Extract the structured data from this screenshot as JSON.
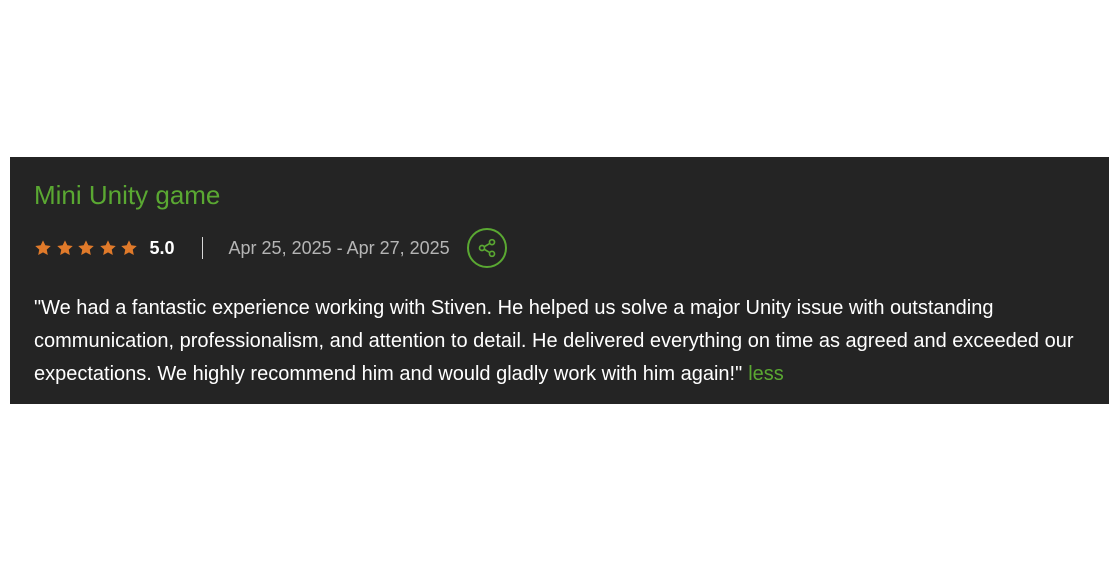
{
  "review": {
    "title": "Mini Unity game",
    "stars": 5,
    "rating": "5.0",
    "date_range": "Apr 25, 2025 - Apr 27, 2025",
    "share_icon": "share-icon",
    "text": "\"We had a fantastic experience working with Stiven. He helped us solve a major Unity issue with outstanding communication, professionalism, and attention to detail. He delivered everything on time as agreed and exceeded our expectations. We highly recommend him and would gladly work with him again!\"",
    "less_label": "less"
  },
  "colors": {
    "card_background": "#242424",
    "accent_green": "#5aa832",
    "star_orange": "#e07a2a",
    "text_white": "#ffffff",
    "text_muted": "#b5b5b5"
  }
}
